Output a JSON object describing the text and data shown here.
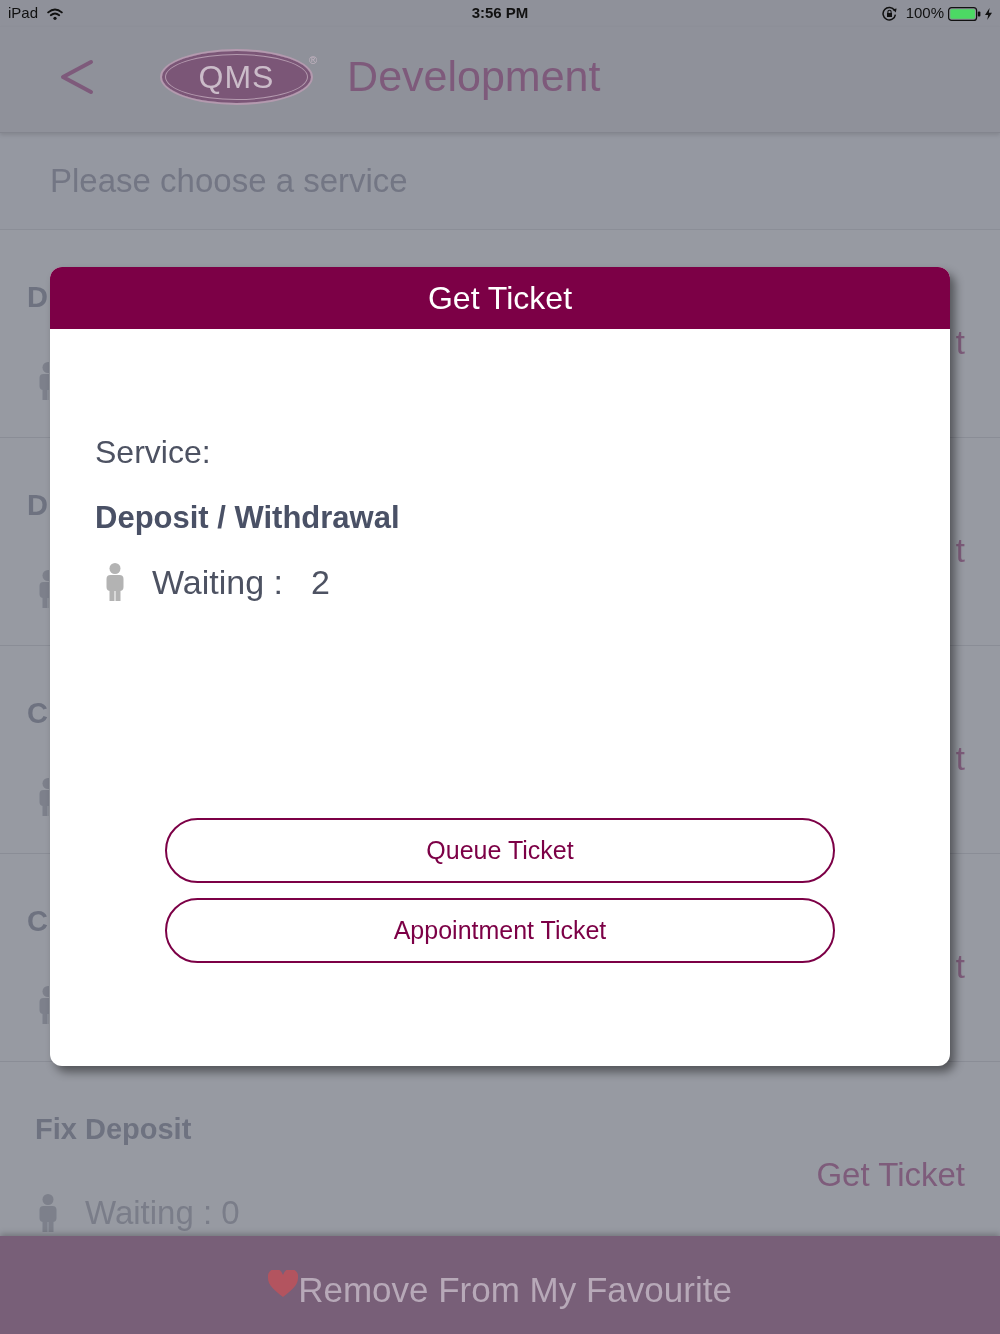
{
  "status_bar": {
    "device": "iPad",
    "time": "3:56 PM",
    "battery": "100%"
  },
  "header": {
    "logo_text": "QMS",
    "logo_mark": "®",
    "title": "Development"
  },
  "prompt": "Please choose a service",
  "services": [
    {
      "kind": "covered",
      "name": "D",
      "action": "t"
    },
    {
      "kind": "covered",
      "name": "D",
      "action": "t"
    },
    {
      "kind": "covered",
      "name": "C",
      "action": "t"
    },
    {
      "kind": "covered",
      "name": "C",
      "action": "t"
    },
    {
      "kind": "full",
      "name": "Fix Deposit",
      "waiting": "Waiting : 0",
      "action": "Get Ticket"
    }
  ],
  "dialog": {
    "title": "Get Ticket",
    "service_label": "Service:",
    "service_name": "Deposit / Withdrawal",
    "waiting_label": "Waiting :",
    "waiting_count": "2",
    "buttons": [
      "Queue Ticket",
      "Appointment Ticket"
    ]
  },
  "bottom_bar": {
    "label": "Remove From My Favourite"
  }
}
